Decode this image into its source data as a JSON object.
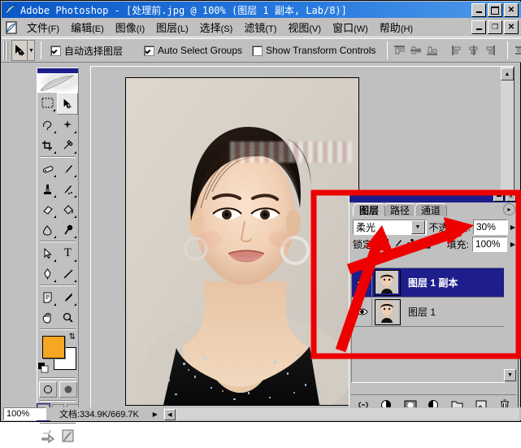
{
  "window": {
    "title": "Adobe Photoshop - [处理前.jpg @ 100% (图层 1 副本, Lab/8)]",
    "app_icon": "photoshop-icon",
    "buttons": {
      "minimize": "_",
      "maximize": "❐",
      "close": "✕"
    },
    "doc_buttons": {
      "minimize": "_",
      "restore": "❐",
      "close": "✕"
    }
  },
  "menubar": {
    "icon": "document-icon",
    "items": [
      {
        "label": "文件",
        "key": "(F)"
      },
      {
        "label": "编辑",
        "key": "(E)"
      },
      {
        "label": "图像",
        "key": "(I)"
      },
      {
        "label": "图层",
        "key": "(L)"
      },
      {
        "label": "选择",
        "key": "(S)"
      },
      {
        "label": "滤镜",
        "key": "(T)"
      },
      {
        "label": "视图",
        "key": "(V)"
      },
      {
        "label": "窗口",
        "key": "(W)"
      },
      {
        "label": "帮助",
        "key": "(H)"
      }
    ]
  },
  "options_bar": {
    "tool_icon": "move-tool-icon",
    "tool_dropdown_icon": "chevron-down-icon",
    "checkboxes": [
      {
        "label": "自动选择图层",
        "checked": true
      },
      {
        "label": "Auto Select Groups",
        "checked": true
      },
      {
        "label": "Show Transform Controls",
        "checked": false
      }
    ],
    "align_icons": [
      "align-top-icon",
      "align-vertical-center-icon",
      "align-bottom-icon",
      "align-left-icon",
      "align-horizontal-center-icon",
      "align-right-icon",
      "distribute-icon"
    ]
  },
  "toolbox": {
    "tools": [
      [
        "marquee-tool",
        "move-tool"
      ],
      [
        "lasso-tool",
        "magic-wand-tool"
      ],
      [
        "crop-tool",
        "slice-tool"
      ],
      [
        "healing-brush-tool",
        "brush-tool"
      ],
      [
        "clone-stamp-tool",
        "history-brush-tool"
      ],
      [
        "eraser-tool",
        "paint-bucket-tool"
      ],
      [
        "blur-tool",
        "dodge-tool"
      ],
      [
        "path-selection-tool",
        "type-tool"
      ],
      [
        "pen-tool",
        "line-tool"
      ],
      [
        "notes-tool",
        "eyedropper-tool"
      ],
      [
        "hand-tool",
        "zoom-tool"
      ]
    ],
    "selected_tool": "move-tool",
    "foreground_color": "#f5a623",
    "background_color": "#ffffff",
    "swap_icon": "swap-colors-icon",
    "default_colors_icon": "default-colors-icon",
    "mask_modes": [
      "standard-mask-mode",
      "quick-mask-mode"
    ],
    "screen_modes": [
      "standard-screen-mode",
      "full-screen-menubar-mode",
      "full-screen-mode"
    ],
    "jump_to": [
      "jump-to-imageready-icon",
      "imageready-icon"
    ]
  },
  "layers_palette": {
    "title_buttons": {
      "minimize": "▬",
      "close": "✕"
    },
    "tabs": [
      {
        "label": "图层",
        "active": true
      },
      {
        "label": "路径",
        "active": false
      },
      {
        "label": "通道",
        "active": false
      }
    ],
    "menu_icon": "palette-menu-icon",
    "blend_mode": "柔光",
    "blend_dropdown_icon": "chevron-down-icon",
    "opacity_label": "不透明度:",
    "opacity_value": "30%",
    "opacity_arrow_icon": "chevron-right-icon",
    "lock_label": "锁定:",
    "lock_icons": [
      "lock-transparency-icon",
      "lock-image-pixels-icon",
      "lock-position-icon",
      "lock-all-icon"
    ],
    "fill_label": "填充:",
    "fill_value": "100%",
    "fill_arrow_icon": "chevron-right-icon",
    "layers": [
      {
        "name": "图层 1 副本",
        "visible": true,
        "selected": true,
        "eye_icon": "eye-icon",
        "thumbnail": "layer-thumbnail"
      },
      {
        "name": "图层 1",
        "visible": true,
        "selected": false,
        "eye_icon": "eye-icon",
        "thumbnail": "layer-thumbnail"
      }
    ],
    "scroll_down_icon": "scroll-down-icon",
    "bottom_buttons": [
      "link-layers-icon",
      "layer-style-icon",
      "layer-mask-icon",
      "adjustment-layer-icon",
      "new-group-icon",
      "new-layer-icon",
      "delete-layer-icon"
    ]
  },
  "document": {
    "scroll_up_icon": "scroll-up-icon",
    "watermark": "blurred-watermark"
  },
  "status_bar": {
    "zoom": "100%",
    "doc_info": "文档:334.9K/669.7K",
    "expand_icon": "status-expand-icon",
    "scroll_left_icon": "scroll-left-icon",
    "scroll_right_icon": "scroll-right-icon"
  },
  "annotations": {
    "highlight_color": "#ee0000",
    "rectangle": "red-highlight-rectangle",
    "arrow_blend_mode": "red-arrow-to-blend-mode",
    "arrow_opacity": "red-arrow-to-opacity"
  }
}
